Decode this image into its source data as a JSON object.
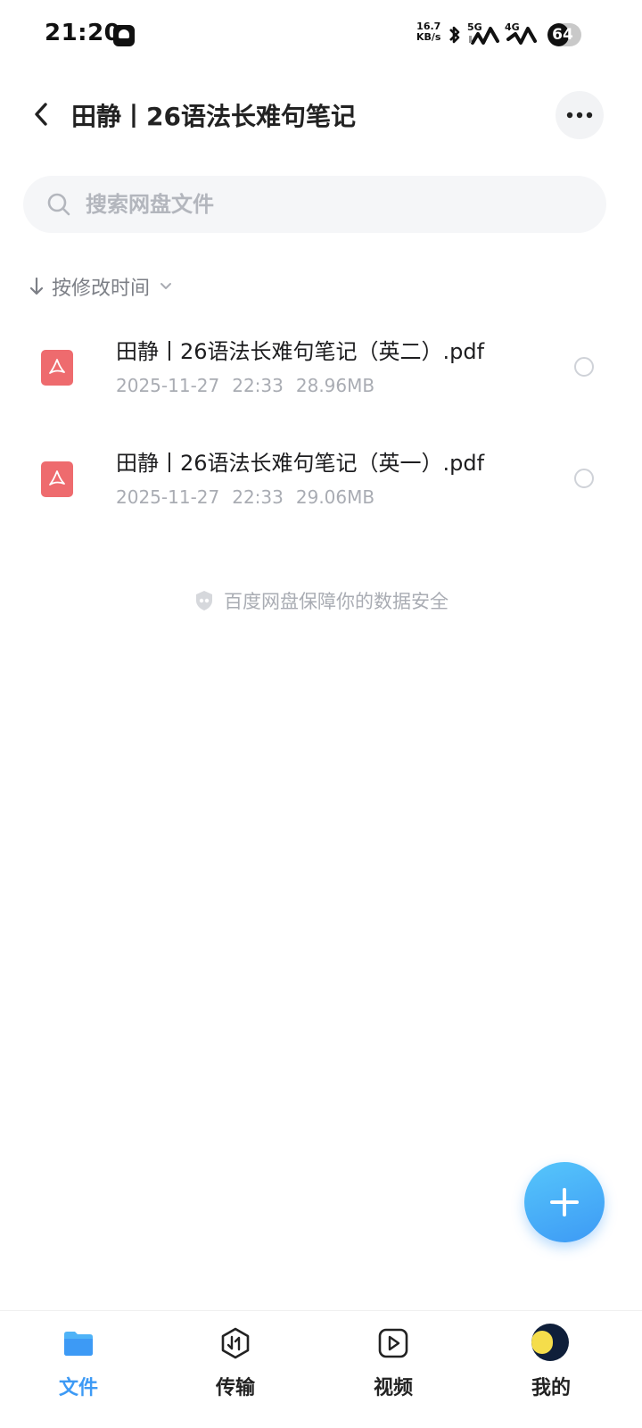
{
  "status_bar": {
    "time": "21:20",
    "net_speed_value": "16.7",
    "net_speed_unit": "KB/s",
    "network_1": "5G",
    "network_2": "4G",
    "battery": "64",
    "battery_level": 0.64
  },
  "header": {
    "title": "田静丨26语法长难句笔记"
  },
  "search": {
    "placeholder": "搜索网盘文件"
  },
  "sort": {
    "label": "按修改时间"
  },
  "files": [
    {
      "name": "田静丨26语法长难句笔记（英二）.pdf",
      "date": "2025-11-27",
      "time": "22:33",
      "size": "28.96MB",
      "icon": "pdf-icon"
    },
    {
      "name": "田静丨26语法长难句笔记（英一）.pdf",
      "date": "2025-11-27",
      "time": "22:33",
      "size": "29.06MB",
      "icon": "pdf-icon"
    }
  ],
  "footer_note": "百度网盘保障你的数据安全",
  "bottom_nav": {
    "items": [
      {
        "label": "文件",
        "icon": "folder-icon",
        "active": true
      },
      {
        "label": "传输",
        "icon": "transfer-icon",
        "active": false
      },
      {
        "label": "视频",
        "icon": "video-play-icon",
        "active": false
      },
      {
        "label": "我的",
        "icon": "avatar",
        "active": false
      }
    ]
  },
  "colors": {
    "accent": "#3d9af5",
    "pdf_red": "#ee6b6e",
    "muted_text": "#a9acb3"
  }
}
